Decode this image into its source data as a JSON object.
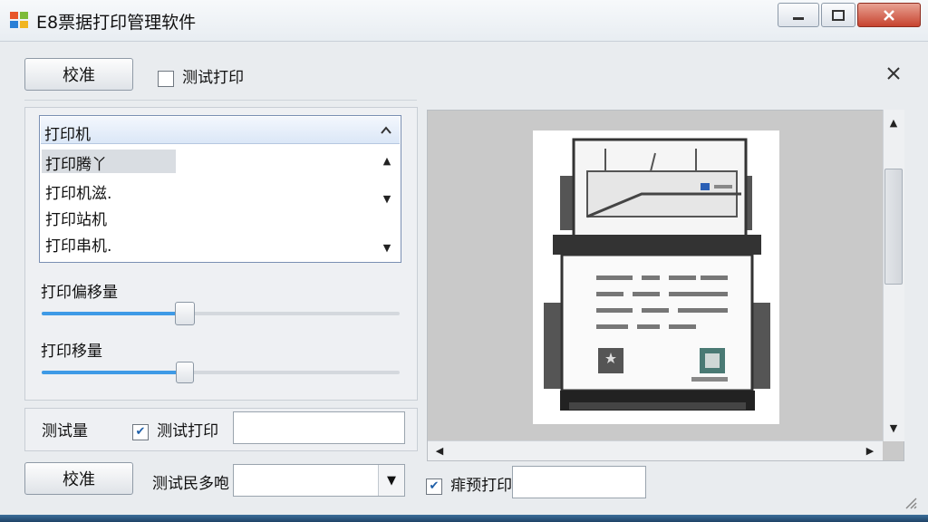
{
  "window": {
    "title": "E8票据打印管理软件"
  },
  "top": {
    "calibrate_label": "校准",
    "test_print_label": "测试打印",
    "test_print_checked": false
  },
  "printer_list": {
    "header": "打印机",
    "items": [
      "打印腾丫",
      "打印机滋.",
      "打印站机",
      "打印串机."
    ]
  },
  "sliders": {
    "offset_label": "打印偏移量",
    "offset_value": 0.4,
    "shift_label": "打印移量",
    "shift_value": 0.4
  },
  "test_row": {
    "label": "测试量",
    "checkbox_label": "测试打印",
    "checked": true,
    "input_value": ""
  },
  "bottom": {
    "calibrate_label": "校准",
    "combo_label": "测试民多咆",
    "combo_value": "",
    "preview_label": "痱预打印",
    "preview_checked": true,
    "preview_input_value": ""
  }
}
